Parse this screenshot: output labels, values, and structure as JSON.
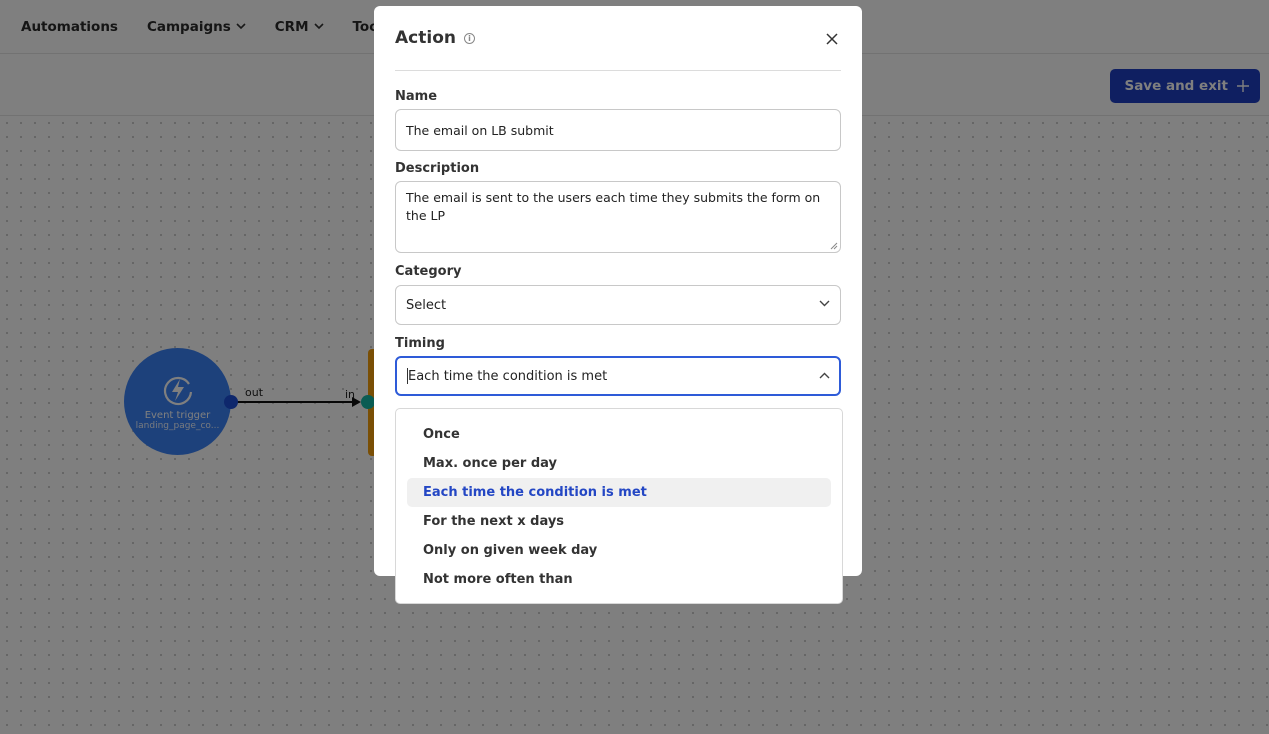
{
  "topnav": {
    "items": [
      {
        "label": "Automations",
        "has_dropdown": false
      },
      {
        "label": "Campaigns",
        "has_dropdown": true
      },
      {
        "label": "CRM",
        "has_dropdown": true
      },
      {
        "label": "Tools",
        "has_dropdown": true
      }
    ]
  },
  "toolbar": {
    "save_label": "Save and exit",
    "save_icon": "plus-icon",
    "accent_color": "#1f3fc2"
  },
  "canvas": {
    "trigger_node": {
      "icon": "lightning-icon",
      "title": "Event trigger",
      "subtitle": "landing_page_co..."
    },
    "edge": {
      "out_label": "out",
      "in_label": "in"
    }
  },
  "modal": {
    "title": "Action",
    "info_icon": "info-icon",
    "close_icon": "close-icon",
    "name": {
      "label": "Name",
      "value": "The email on LB submit"
    },
    "description": {
      "label": "Description",
      "value": "The email is sent to the users each time they submits the form on the LP"
    },
    "category": {
      "label": "Category",
      "value": "Select"
    },
    "timing": {
      "label": "Timing",
      "value": "Each time the condition is met"
    }
  },
  "timing_dropdown": {
    "options": [
      {
        "label": "Once",
        "selected": false
      },
      {
        "label": "Max. once per day",
        "selected": false
      },
      {
        "label": "Each time the condition is met",
        "selected": true
      },
      {
        "label": "For the next x days",
        "selected": false
      },
      {
        "label": "Only on given week day",
        "selected": false
      },
      {
        "label": "Not more often than",
        "selected": false
      }
    ],
    "selected_color": "#2447c4"
  }
}
